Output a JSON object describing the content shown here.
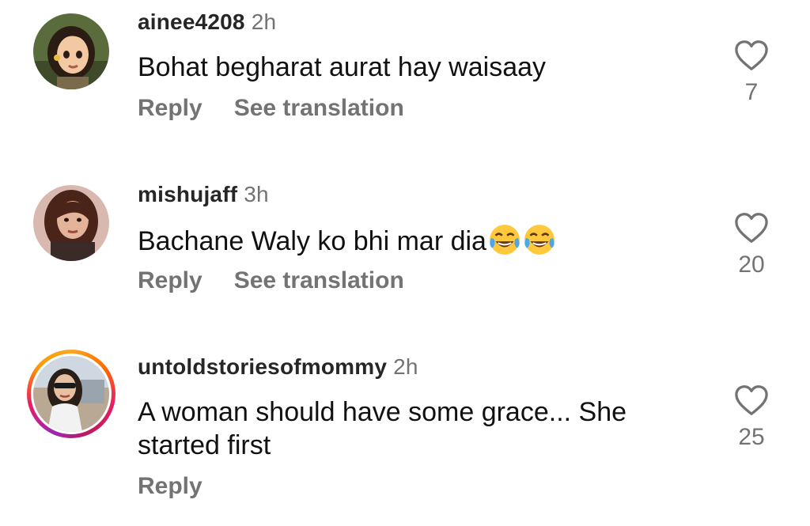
{
  "comments": [
    {
      "username": "ainee4208",
      "time": "2h",
      "text": "Bohat begharat aurat hay waisaay",
      "reply_label": "Reply",
      "translate_label": "See translation",
      "likes": "7",
      "avatar_icon": "cartoon-girl-avatar"
    },
    {
      "username": "mishujaff",
      "time": "3h",
      "text": "Bachane Waly ko bhi mar dia",
      "emoji": "face-with-tears-of-joy-emoji",
      "reply_label": "Reply",
      "translate_label": "See translation",
      "likes": "20",
      "avatar_icon": "woman-portrait-avatar"
    },
    {
      "username": "untoldstoriesofmommy",
      "time": "2h",
      "text_line1": "A woman should have some grace... She",
      "text_line2": "started first",
      "reply_label": "Reply",
      "likes": "25",
      "avatar_icon": "woman-sunglasses-avatar",
      "has_story_ring": true
    }
  ],
  "colors": {
    "username": "#262626",
    "secondary": "#737373",
    "text": "#111111"
  }
}
